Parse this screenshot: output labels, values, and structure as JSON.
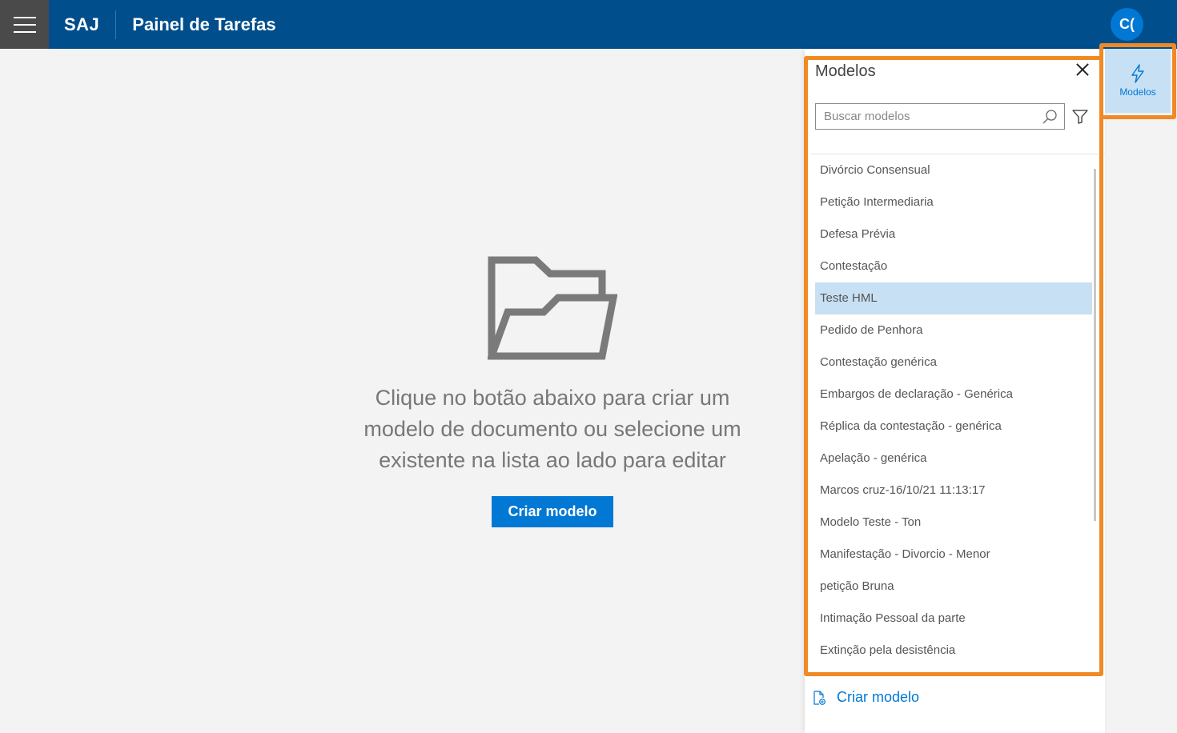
{
  "header": {
    "brand": "SAJ",
    "title": "Painel de Tarefas",
    "avatar_initials": "C("
  },
  "main": {
    "empty_message": "Clique no botão abaixo para criar um modelo de documento ou selecione um existente na lista ao lado para editar",
    "create_button": "Criar modelo"
  },
  "panel": {
    "title": "Modelos",
    "search_placeholder": "Buscar modelos",
    "selected_item": "Teste HML",
    "items": [
      "Divórcio Consensual",
      "Petição Intermediaria",
      "Defesa Prévia",
      "Contestação",
      "Teste HML",
      "Pedido de Penhora",
      "Contestação genérica",
      "Embargos de declaração - Genérica",
      "Réplica da contestação - genérica",
      "Apelação - genérica",
      "Marcos cruz-16/10/21 11:13:17",
      "Modelo Teste - Ton",
      "Manifestação - Divorcio - Menor",
      "petição Bruna",
      "Intimação Pessoal da parte",
      "Extinção pela desistência"
    ],
    "footer_action": "Criar modelo"
  },
  "rail": {
    "label": "Modelos",
    "icon": "lightning-icon"
  },
  "colors": {
    "header_bg": "#004e8c",
    "accent": "#0078d4",
    "selected_bg": "#c7e0f4",
    "highlight": "#f08a24"
  }
}
